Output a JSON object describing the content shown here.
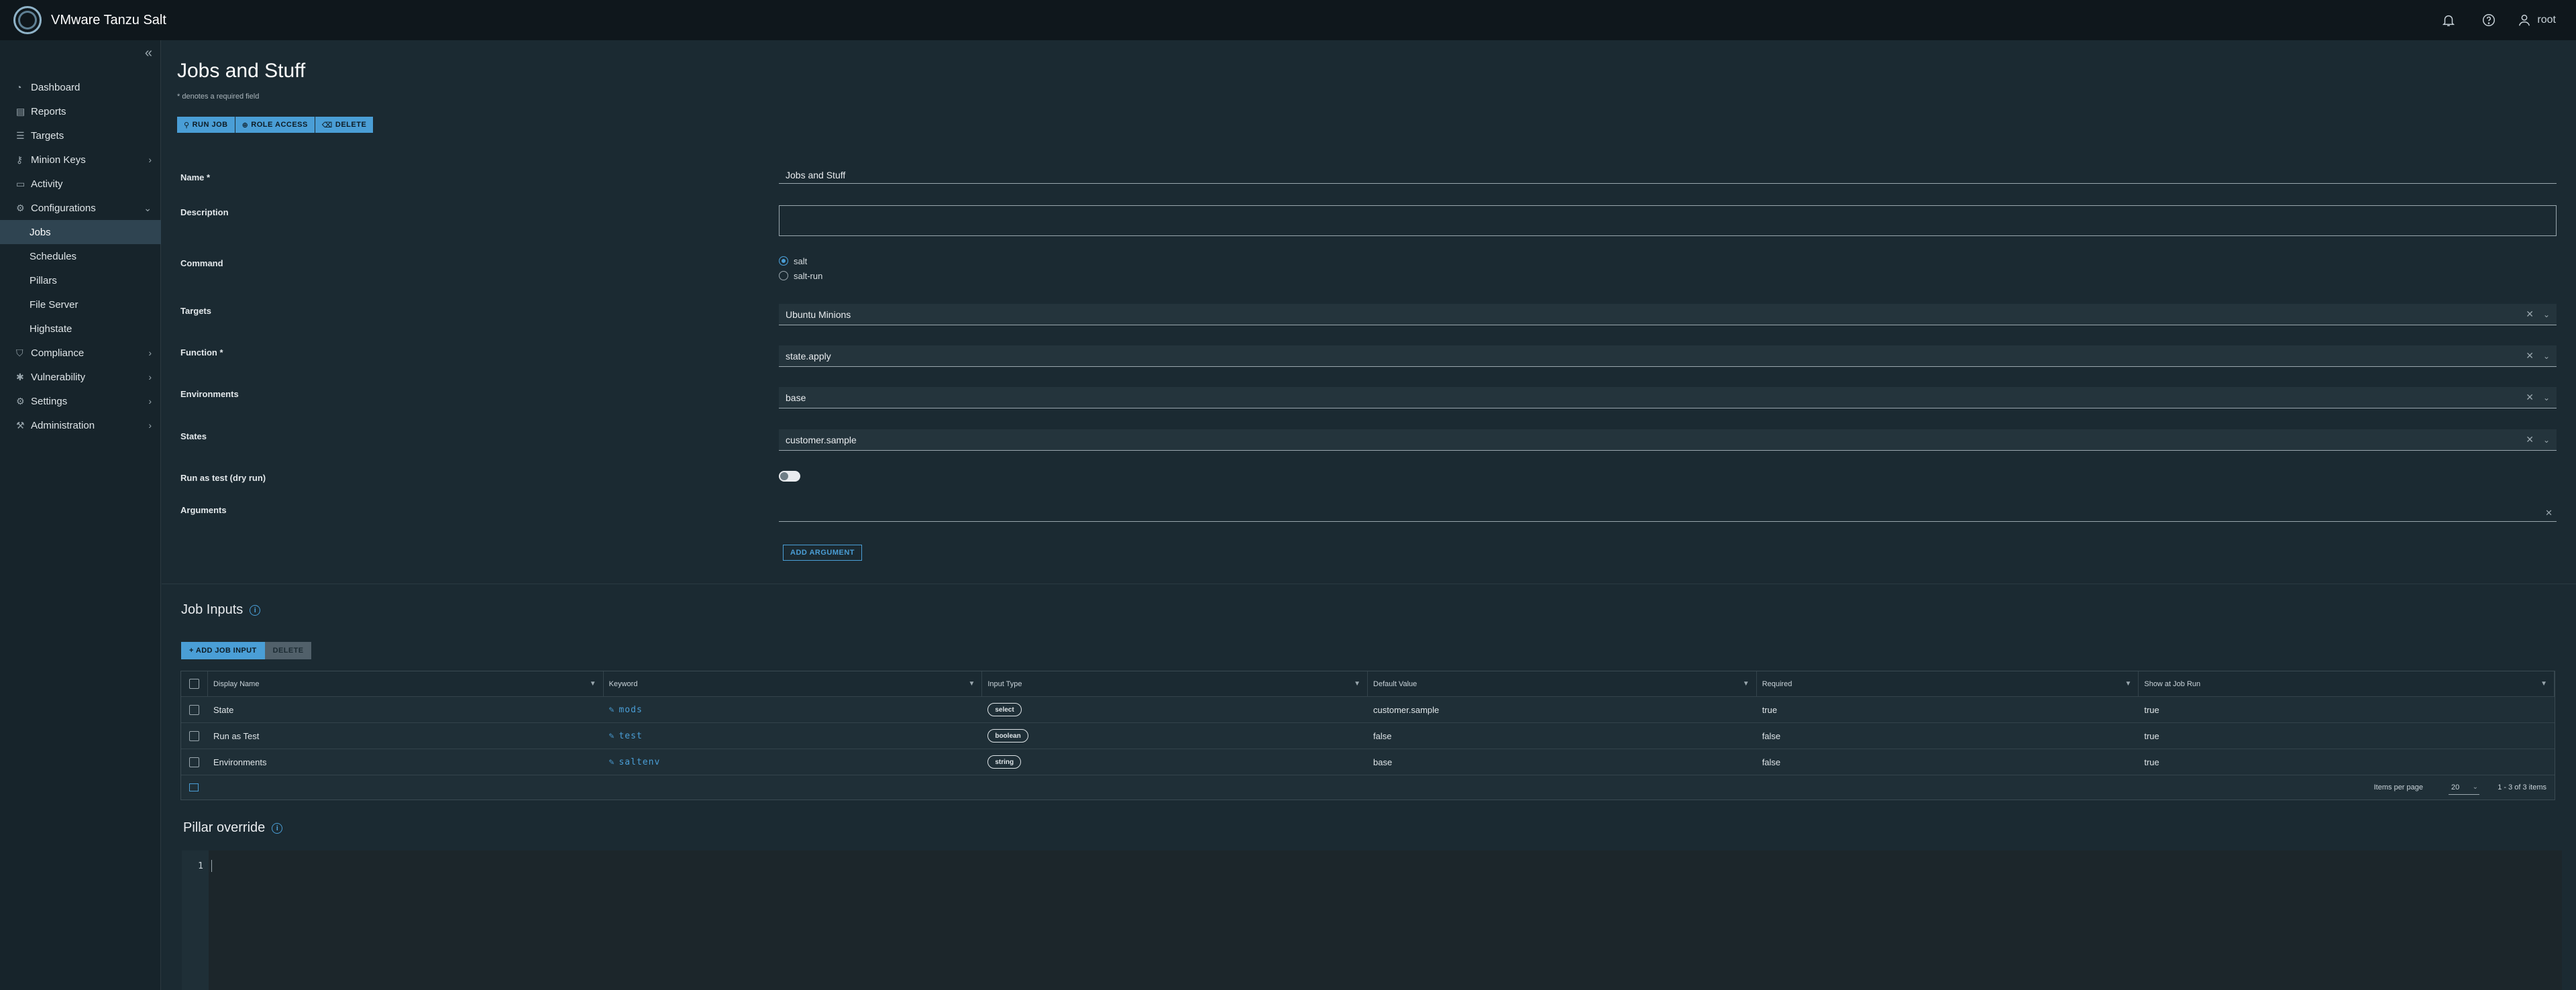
{
  "app": {
    "title": "VMware Tanzu Salt",
    "user": "root"
  },
  "icons": {
    "bell": "bell-icon",
    "help": "help-icon",
    "user": "user-icon"
  },
  "sidebar": {
    "items": [
      {
        "label": "Dashboard",
        "icon": "dashboard-icon"
      },
      {
        "label": "Reports",
        "icon": "reports-icon"
      },
      {
        "label": "Targets",
        "icon": "targets-icon"
      },
      {
        "label": "Minion Keys",
        "icon": "key-icon"
      },
      {
        "label": "Activity",
        "icon": "activity-icon"
      },
      {
        "label": "Configurations",
        "icon": "gear-icon"
      },
      {
        "label": "Jobs"
      },
      {
        "label": "Schedules"
      },
      {
        "label": "Pillars"
      },
      {
        "label": "File Server"
      },
      {
        "label": "Highstate"
      },
      {
        "label": "Compliance",
        "icon": "shield-icon"
      },
      {
        "label": "Vulnerability",
        "icon": "bug-icon"
      },
      {
        "label": "Settings",
        "icon": "settings-icon"
      },
      {
        "label": "Administration",
        "icon": "wrench-icon"
      }
    ],
    "active": "Jobs"
  },
  "page": {
    "title": "Jobs and Stuff",
    "required_note": "* denotes a required field",
    "actions": {
      "run_job": "RUN JOB",
      "role_access": "ROLE ACCESS",
      "delete": "DELETE"
    }
  },
  "form": {
    "name_label": "Name",
    "name_value": "Jobs and Stuff",
    "description_label": "Description",
    "description_value": "",
    "command_label": "Command",
    "command_options": [
      "salt",
      "salt-run"
    ],
    "command_selected": "salt",
    "targets_label": "Targets",
    "targets_value": "Ubuntu Minions",
    "function_label": "Function",
    "function_value": "state.apply",
    "environments_label": "Environments",
    "environments_value": "base",
    "states_label": "States",
    "states_value": "customer.sample",
    "dry_run_label": "Run as test (dry run)",
    "dry_run_on": false,
    "arguments_label": "Arguments",
    "arguments_value": "",
    "add_argument": "ADD ARGUMENT"
  },
  "job_inputs": {
    "title": "Job Inputs",
    "add_label": "+ ADD JOB INPUT",
    "delete_label": "DELETE",
    "columns": [
      "Display Name",
      "Keyword",
      "Input Type",
      "Default Value",
      "Required",
      "Show at Job Run"
    ],
    "rows": [
      {
        "display": "State",
        "keyword": "mods",
        "type": "select",
        "default": "customer.sample",
        "required": "true",
        "show": "true"
      },
      {
        "display": "Run as Test",
        "keyword": "test",
        "type": "boolean",
        "default": "false",
        "required": "false",
        "show": "true"
      },
      {
        "display": "Environments",
        "keyword": "saltenv",
        "type": "string",
        "default": "base",
        "required": "false",
        "show": "true"
      }
    ],
    "items_per_page_label": "Items per page",
    "items_per_page": "20",
    "range": "1 - 3 of 3 items"
  },
  "pillar": {
    "title": "Pillar override",
    "line_number": "1"
  }
}
